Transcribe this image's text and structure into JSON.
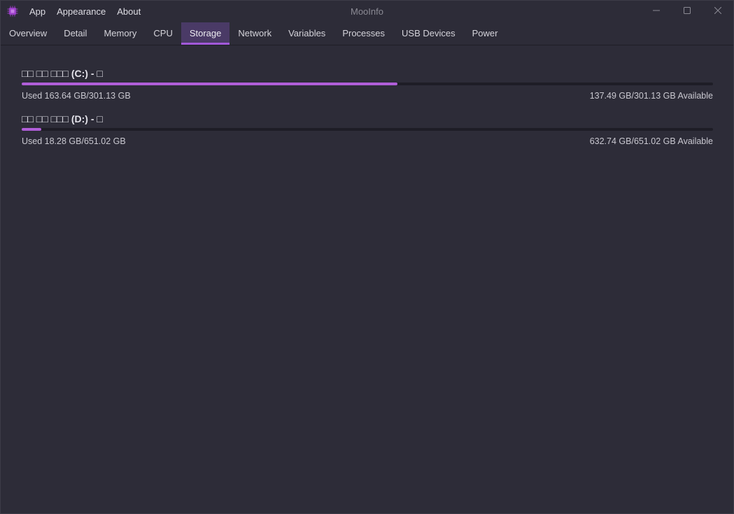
{
  "app": {
    "title": "MooInfo",
    "icon": "chip-icon",
    "accent_color": "#a259d9"
  },
  "menu": {
    "items": [
      {
        "label": "App"
      },
      {
        "label": "Appearance"
      },
      {
        "label": "About"
      }
    ]
  },
  "window_controls": [
    "minimize-icon",
    "maximize-icon",
    "close-icon"
  ],
  "tabs": {
    "active": "Storage",
    "items": [
      {
        "label": "Overview"
      },
      {
        "label": "Detail"
      },
      {
        "label": "Memory"
      },
      {
        "label": "CPU"
      },
      {
        "label": "Storage"
      },
      {
        "label": "Network"
      },
      {
        "label": "Variables"
      },
      {
        "label": "Processes"
      },
      {
        "label": "USB Devices"
      },
      {
        "label": "Power"
      }
    ]
  },
  "storage": {
    "drives": [
      {
        "title": "□□ □□ □□□ (C:) - □",
        "used_fraction": 0.5435,
        "used_text": "Used 163.64 GB/301.13 GB",
        "available_text": "137.49 GB/301.13 GB Available"
      },
      {
        "title": "□□ □□ □□□ (D:) - □",
        "used_fraction": 0.0281,
        "used_text": "Used 18.28 GB/651.02 GB",
        "available_text": "632.74 GB/651.02 GB Available"
      }
    ]
  }
}
